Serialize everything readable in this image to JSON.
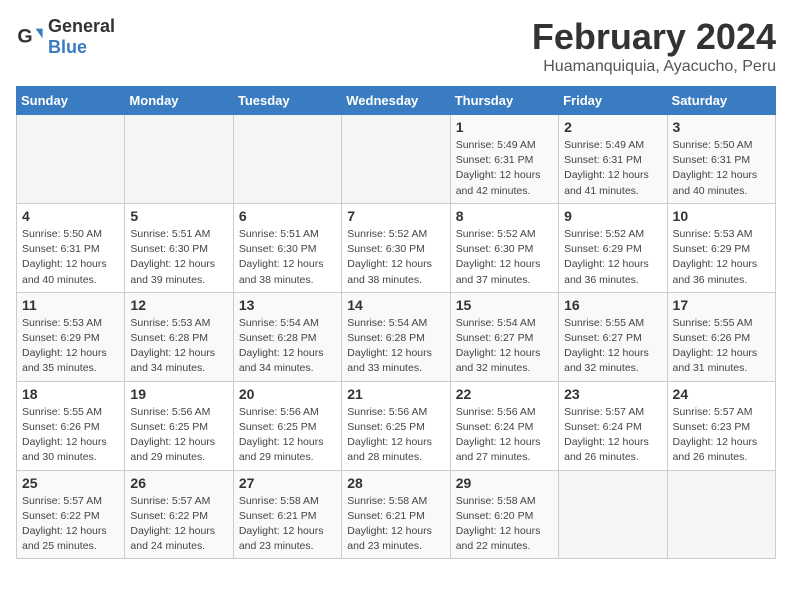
{
  "header": {
    "logo_general": "General",
    "logo_blue": "Blue",
    "title": "February 2024",
    "subtitle": "Huamanquiquia, Ayacucho, Peru"
  },
  "weekdays": [
    "Sunday",
    "Monday",
    "Tuesday",
    "Wednesday",
    "Thursday",
    "Friday",
    "Saturday"
  ],
  "weeks": [
    [
      {
        "day": "",
        "info": ""
      },
      {
        "day": "",
        "info": ""
      },
      {
        "day": "",
        "info": ""
      },
      {
        "day": "",
        "info": ""
      },
      {
        "day": "1",
        "info": "Sunrise: 5:49 AM\nSunset: 6:31 PM\nDaylight: 12 hours\nand 42 minutes."
      },
      {
        "day": "2",
        "info": "Sunrise: 5:49 AM\nSunset: 6:31 PM\nDaylight: 12 hours\nand 41 minutes."
      },
      {
        "day": "3",
        "info": "Sunrise: 5:50 AM\nSunset: 6:31 PM\nDaylight: 12 hours\nand 40 minutes."
      }
    ],
    [
      {
        "day": "4",
        "info": "Sunrise: 5:50 AM\nSunset: 6:31 PM\nDaylight: 12 hours\nand 40 minutes."
      },
      {
        "day": "5",
        "info": "Sunrise: 5:51 AM\nSunset: 6:30 PM\nDaylight: 12 hours\nand 39 minutes."
      },
      {
        "day": "6",
        "info": "Sunrise: 5:51 AM\nSunset: 6:30 PM\nDaylight: 12 hours\nand 38 minutes."
      },
      {
        "day": "7",
        "info": "Sunrise: 5:52 AM\nSunset: 6:30 PM\nDaylight: 12 hours\nand 38 minutes."
      },
      {
        "day": "8",
        "info": "Sunrise: 5:52 AM\nSunset: 6:30 PM\nDaylight: 12 hours\nand 37 minutes."
      },
      {
        "day": "9",
        "info": "Sunrise: 5:52 AM\nSunset: 6:29 PM\nDaylight: 12 hours\nand 36 minutes."
      },
      {
        "day": "10",
        "info": "Sunrise: 5:53 AM\nSunset: 6:29 PM\nDaylight: 12 hours\nand 36 minutes."
      }
    ],
    [
      {
        "day": "11",
        "info": "Sunrise: 5:53 AM\nSunset: 6:29 PM\nDaylight: 12 hours\nand 35 minutes."
      },
      {
        "day": "12",
        "info": "Sunrise: 5:53 AM\nSunset: 6:28 PM\nDaylight: 12 hours\nand 34 minutes."
      },
      {
        "day": "13",
        "info": "Sunrise: 5:54 AM\nSunset: 6:28 PM\nDaylight: 12 hours\nand 34 minutes."
      },
      {
        "day": "14",
        "info": "Sunrise: 5:54 AM\nSunset: 6:28 PM\nDaylight: 12 hours\nand 33 minutes."
      },
      {
        "day": "15",
        "info": "Sunrise: 5:54 AM\nSunset: 6:27 PM\nDaylight: 12 hours\nand 32 minutes."
      },
      {
        "day": "16",
        "info": "Sunrise: 5:55 AM\nSunset: 6:27 PM\nDaylight: 12 hours\nand 32 minutes."
      },
      {
        "day": "17",
        "info": "Sunrise: 5:55 AM\nSunset: 6:26 PM\nDaylight: 12 hours\nand 31 minutes."
      }
    ],
    [
      {
        "day": "18",
        "info": "Sunrise: 5:55 AM\nSunset: 6:26 PM\nDaylight: 12 hours\nand 30 minutes."
      },
      {
        "day": "19",
        "info": "Sunrise: 5:56 AM\nSunset: 6:25 PM\nDaylight: 12 hours\nand 29 minutes."
      },
      {
        "day": "20",
        "info": "Sunrise: 5:56 AM\nSunset: 6:25 PM\nDaylight: 12 hours\nand 29 minutes."
      },
      {
        "day": "21",
        "info": "Sunrise: 5:56 AM\nSunset: 6:25 PM\nDaylight: 12 hours\nand 28 minutes."
      },
      {
        "day": "22",
        "info": "Sunrise: 5:56 AM\nSunset: 6:24 PM\nDaylight: 12 hours\nand 27 minutes."
      },
      {
        "day": "23",
        "info": "Sunrise: 5:57 AM\nSunset: 6:24 PM\nDaylight: 12 hours\nand 26 minutes."
      },
      {
        "day": "24",
        "info": "Sunrise: 5:57 AM\nSunset: 6:23 PM\nDaylight: 12 hours\nand 26 minutes."
      }
    ],
    [
      {
        "day": "25",
        "info": "Sunrise: 5:57 AM\nSunset: 6:22 PM\nDaylight: 12 hours\nand 25 minutes."
      },
      {
        "day": "26",
        "info": "Sunrise: 5:57 AM\nSunset: 6:22 PM\nDaylight: 12 hours\nand 24 minutes."
      },
      {
        "day": "27",
        "info": "Sunrise: 5:58 AM\nSunset: 6:21 PM\nDaylight: 12 hours\nand 23 minutes."
      },
      {
        "day": "28",
        "info": "Sunrise: 5:58 AM\nSunset: 6:21 PM\nDaylight: 12 hours\nand 23 minutes."
      },
      {
        "day": "29",
        "info": "Sunrise: 5:58 AM\nSunset: 6:20 PM\nDaylight: 12 hours\nand 22 minutes."
      },
      {
        "day": "",
        "info": ""
      },
      {
        "day": "",
        "info": ""
      }
    ]
  ]
}
